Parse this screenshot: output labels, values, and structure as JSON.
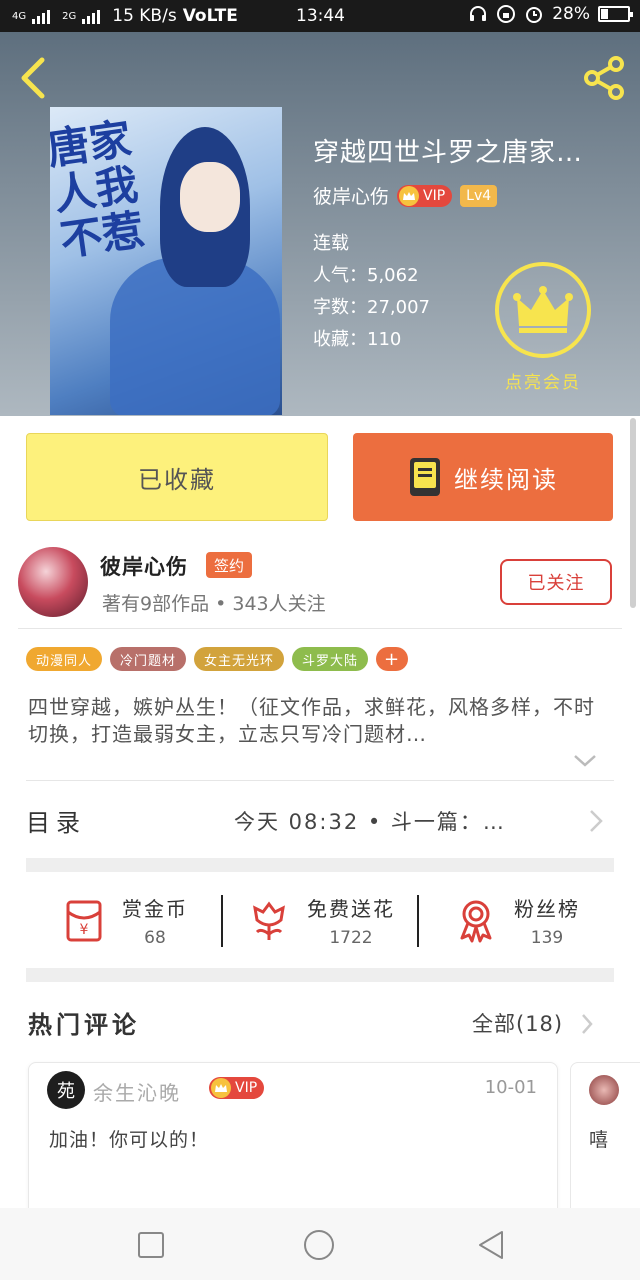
{
  "status_bar": {
    "network_left": "4G",
    "network_right": "2G",
    "speed": "15 KB/s",
    "volte": "VoLTE",
    "time": "13:44",
    "battery_percent": "28%",
    "battery_level": 0.28
  },
  "book": {
    "title": "穿越四世斗罗之唐家…",
    "cover_text": "唐家人我不惹",
    "author": "彼岸心伤",
    "vip_label": "VIP",
    "level": "Lv4",
    "status": "连载",
    "popularity_label": "人气：",
    "popularity": "5,062",
    "words_label": "字数：",
    "words": "27,007",
    "favorites_label": "收藏：",
    "favorites": "110",
    "member_label": "点亮会员"
  },
  "actions": {
    "collected_label": "已收藏",
    "continue_label": "继续阅读"
  },
  "author_info": {
    "name": "彼岸心伤",
    "sign_badge": "签约",
    "stats": "著有9部作品 • 343人关注",
    "follow_label": "已关注"
  },
  "tags": [
    {
      "label": "动漫同人",
      "color": "#f0a830"
    },
    {
      "label": "冷门题材",
      "color": "#b8706a"
    },
    {
      "label": "女主无光环",
      "color": "#d2a33c"
    },
    {
      "label": "斗罗大陆",
      "color": "#8ebc4d"
    },
    {
      "label": "+",
      "color": "#ec6e3f"
    }
  ],
  "description": "四世穿越，嫉妒丛生！（征文作品，求鲜花，风格多样，不时切换，打造最弱女主，立志只写冷门题材…",
  "catalog": {
    "title": "目录",
    "latest": "今天 08:32 • 斗一篇：…"
  },
  "stats": [
    {
      "label": "赏金币",
      "value": "68",
      "icon": "redpacket-icon"
    },
    {
      "label": "免费送花",
      "value": "1722",
      "icon": "flower-icon"
    },
    {
      "label": "粉丝榜",
      "value": "139",
      "icon": "medal-icon"
    }
  ],
  "hot_comments": {
    "title": "热门评论",
    "all_label": "全部(18)",
    "items": [
      {
        "avatar_text": "苑",
        "name": "余生沁晚",
        "vip": "VIP",
        "date": "10-01",
        "text": "加油！你可以的！"
      },
      {
        "text": "嘻"
      }
    ]
  },
  "colors": {
    "accent_orange": "#ec6e3f",
    "collected_yellow": "#fdf17c",
    "member_gold": "#f7e44e",
    "follow_red": "#d9403a"
  }
}
